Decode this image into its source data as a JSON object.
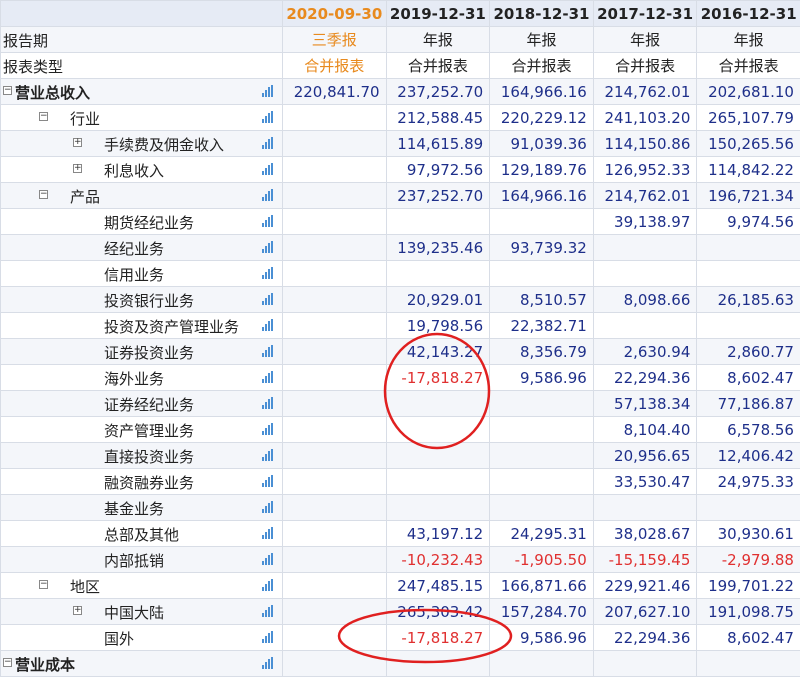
{
  "header": {
    "periods": [
      {
        "label": "2020-09-30",
        "current": true
      },
      {
        "label": "2019-12-31",
        "current": false
      },
      {
        "label": "2018-12-31",
        "current": false
      },
      {
        "label": "2017-12-31",
        "current": false
      },
      {
        "label": "2016-12-31",
        "current": false
      }
    ]
  },
  "meta_rows": [
    {
      "label": "报告期",
      "values": [
        "三季报",
        "年报",
        "年报",
        "年报",
        "年报"
      ]
    },
    {
      "label": "报表类型",
      "values": [
        "合并报表",
        "合并报表",
        "合并报表",
        "合并报表",
        "合并报表"
      ]
    }
  ],
  "rows": [
    {
      "label": "营业总收入",
      "level": 0,
      "expander": "−",
      "bold": true,
      "values": [
        "220,841.70",
        "237,252.70",
        "164,966.16",
        "214,762.01",
        "202,681.10"
      ]
    },
    {
      "label": "行业",
      "level": 1,
      "expander": "−",
      "values": [
        "",
        "212,588.45",
        "220,229.12",
        "241,103.20",
        "265,107.79"
      ]
    },
    {
      "label": "手续费及佣金收入",
      "level": 2,
      "expander": "+",
      "values": [
        "",
        "114,615.89",
        "91,039.36",
        "114,150.86",
        "150,265.56"
      ]
    },
    {
      "label": "利息收入",
      "level": 2,
      "expander": "+",
      "values": [
        "",
        "97,972.56",
        "129,189.76",
        "126,952.33",
        "114,842.22"
      ]
    },
    {
      "label": "产品",
      "level": 1,
      "expander": "−",
      "values": [
        "",
        "237,252.70",
        "164,966.16",
        "214,762.01",
        "196,721.34"
      ]
    },
    {
      "label": "期货经纪业务",
      "level": 2,
      "expander": "",
      "values": [
        "",
        "",
        "",
        "39,138.97",
        "9,974.56"
      ]
    },
    {
      "label": "经纪业务",
      "level": 2,
      "expander": "",
      "values": [
        "",
        "139,235.46",
        "93,739.32",
        "",
        ""
      ]
    },
    {
      "label": "信用业务",
      "level": 2,
      "expander": "",
      "values": [
        "",
        "",
        "",
        "",
        ""
      ]
    },
    {
      "label": "投资银行业务",
      "level": 2,
      "expander": "",
      "values": [
        "",
        "20,929.01",
        "8,510.57",
        "8,098.66",
        "26,185.63"
      ]
    },
    {
      "label": "投资及资产管理业务",
      "level": 2,
      "expander": "",
      "values": [
        "",
        "19,798.56",
        "22,382.71",
        "",
        ""
      ]
    },
    {
      "label": "证券投资业务",
      "level": 2,
      "expander": "",
      "values": [
        "",
        "42,143.27",
        "8,356.79",
        "2,630.94",
        "2,860.77"
      ]
    },
    {
      "label": "海外业务",
      "level": 2,
      "expander": "",
      "values": [
        "",
        "-17,818.27",
        "9,586.96",
        "22,294.36",
        "8,602.47"
      ]
    },
    {
      "label": "证券经纪业务",
      "level": 2,
      "expander": "",
      "values": [
        "",
        "",
        "",
        "57,138.34",
        "77,186.87"
      ]
    },
    {
      "label": "资产管理业务",
      "level": 2,
      "expander": "",
      "values": [
        "",
        "",
        "",
        "8,104.40",
        "6,578.56"
      ]
    },
    {
      "label": "直接投资业务",
      "level": 2,
      "expander": "",
      "values": [
        "",
        "",
        "",
        "20,956.65",
        "12,406.42"
      ]
    },
    {
      "label": "融资融券业务",
      "level": 2,
      "expander": "",
      "values": [
        "",
        "",
        "",
        "33,530.47",
        "24,975.33"
      ]
    },
    {
      "label": "基金业务",
      "level": 2,
      "expander": "",
      "values": [
        "",
        "",
        "",
        "",
        ""
      ]
    },
    {
      "label": "总部及其他",
      "level": 2,
      "expander": "",
      "values": [
        "",
        "43,197.12",
        "24,295.31",
        "38,028.67",
        "30,930.61"
      ]
    },
    {
      "label": "内部抵销",
      "level": 2,
      "expander": "",
      "values": [
        "",
        "-10,232.43",
        "-1,905.50",
        "-15,159.45",
        "-2,979.88"
      ]
    },
    {
      "label": "地区",
      "level": 1,
      "expander": "−",
      "values": [
        "",
        "247,485.15",
        "166,871.66",
        "229,921.46",
        "199,701.22"
      ]
    },
    {
      "label": "中国大陆",
      "level": 2,
      "expander": "+",
      "values": [
        "",
        "265,303.42",
        "157,284.70",
        "207,627.10",
        "191,098.75"
      ]
    },
    {
      "label": "国外",
      "level": 2,
      "expander": "",
      "values": [
        "",
        "-17,818.27",
        "9,586.96",
        "22,294.36",
        "8,602.47"
      ]
    },
    {
      "label": "营业成本",
      "level": 0,
      "expander": "−",
      "bold": true,
      "values": [
        "",
        "",
        "",
        "",
        ""
      ]
    }
  ],
  "annotations": {
    "color": "#e02020"
  },
  "colors": {
    "header_bg": "#e6ebf5",
    "current_period": "#e88a1e",
    "number": "#1e2f8a",
    "negative": "#e03030",
    "icon": "#4a8fd4"
  }
}
